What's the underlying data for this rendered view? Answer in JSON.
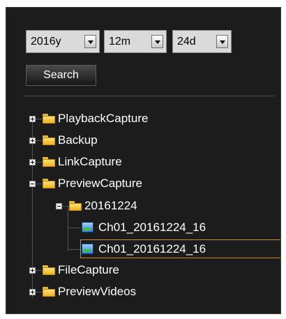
{
  "date_filter": {
    "year": "2016y",
    "month": "12m",
    "day": "24d"
  },
  "search_button": "Search",
  "tree": {
    "playback_capture": "PlaybackCapture",
    "backup": "Backup",
    "link_capture": "LinkCapture",
    "preview_capture": "PreviewCapture",
    "date_folder": "20161224",
    "file_1": "Ch01_20161224_16",
    "file_2": "Ch01_20161224_16",
    "file_capture": "FileCapture",
    "preview_videos": "PreviewVideos"
  },
  "colors": {
    "panel_bg": "#1c1c1c",
    "text": "#ffffff",
    "selection_border": "#c98a3a",
    "folder": "#f0b21a"
  },
  "icons": {
    "collapsed": "plus-box-icon",
    "expanded": "minus-box-icon",
    "folder": "folder-icon",
    "file": "image-file-icon"
  }
}
